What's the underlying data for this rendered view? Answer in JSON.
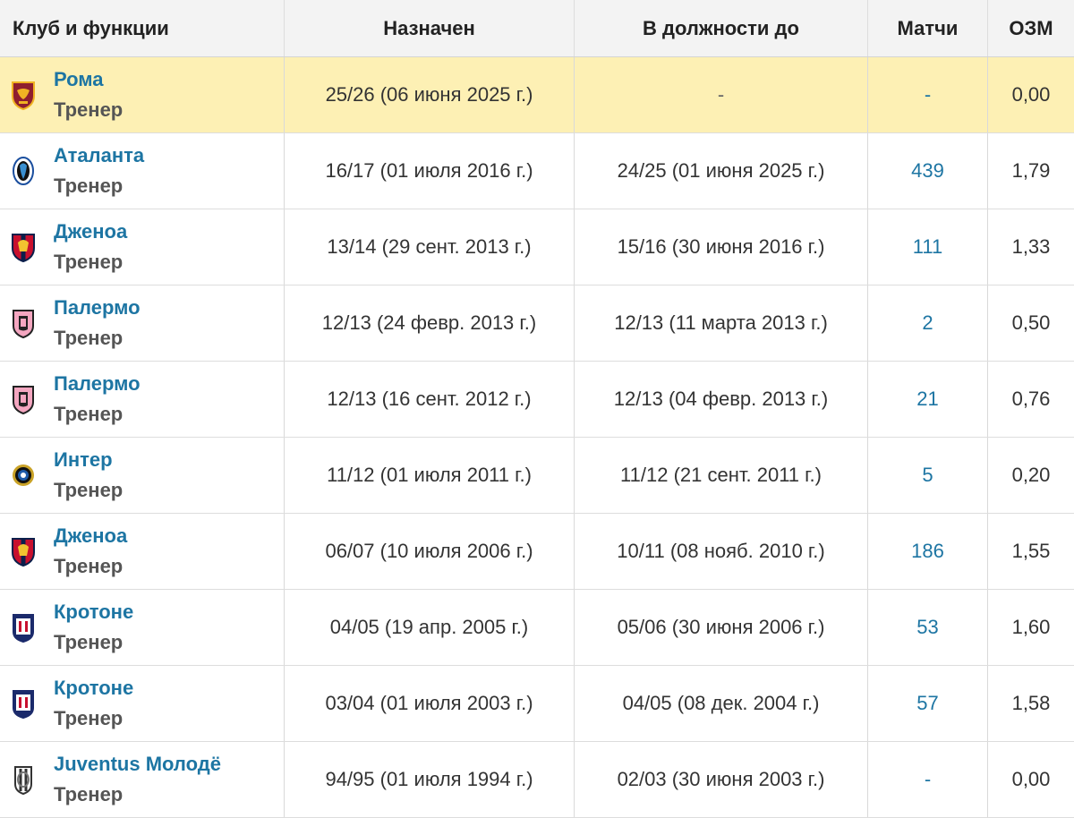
{
  "header": {
    "club": "Клуб и функции",
    "appointed": "Назначен",
    "until": "В должности до",
    "matches": "Матчи",
    "ppm": "ОЗМ"
  },
  "rows": [
    {
      "club": "Рома",
      "role": "Тренер",
      "crest": "roma-crest-icon",
      "appointed": "25/26 (06 июня 2025 г.)",
      "until": "-",
      "matches": "-",
      "ppm": "0,00",
      "current": true
    },
    {
      "club": "Аталанта",
      "role": "Тренер",
      "crest": "atalanta-crest-icon",
      "appointed": "16/17 (01 июля 2016 г.)",
      "until": "24/25 (01 июня 2025 г.)",
      "matches": "439",
      "ppm": "1,79"
    },
    {
      "club": "Дженоа",
      "role": "Тренер",
      "crest": "genoa-crest-icon",
      "appointed": "13/14 (29 сент. 2013 г.)",
      "until": "15/16 (30 июня 2016 г.)",
      "matches": "111",
      "ppm": "1,33"
    },
    {
      "club": "Палермо",
      "role": "Тренер",
      "crest": "palermo-crest-icon",
      "appointed": "12/13 (24 февр. 2013 г.)",
      "until": "12/13 (11 марта 2013 г.)",
      "matches": "2",
      "ppm": "0,50"
    },
    {
      "club": "Палермо",
      "role": "Тренер",
      "crest": "palermo-crest-icon",
      "appointed": "12/13 (16 сент. 2012 г.)",
      "until": "12/13 (04 февр. 2013 г.)",
      "matches": "21",
      "ppm": "0,76"
    },
    {
      "club": "Интер",
      "role": "Тренер",
      "crest": "inter-crest-icon",
      "appointed": "11/12 (01 июля 2011 г.)",
      "until": "11/12 (21 сент. 2011 г.)",
      "matches": "5",
      "ppm": "0,20"
    },
    {
      "club": "Дженоа",
      "role": "Тренер",
      "crest": "genoa-crest-icon",
      "appointed": "06/07 (10 июля 2006 г.)",
      "until": "10/11 (08 нояб. 2010 г.)",
      "matches": "186",
      "ppm": "1,55"
    },
    {
      "club": "Кротоне",
      "role": "Тренер",
      "crest": "crotone-crest-icon",
      "appointed": "04/05 (19 апр. 2005 г.)",
      "until": "05/06 (30 июня 2006 г.)",
      "matches": "53",
      "ppm": "1,60"
    },
    {
      "club": "Кротоне",
      "role": "Тренер",
      "crest": "crotone-crest-icon",
      "appointed": "03/04 (01 июля 2003 г.)",
      "until": "04/05 (08 дек. 2004 г.)",
      "matches": "57",
      "ppm": "1,58"
    },
    {
      "club": "Juventus Молодё",
      "role": "Тренер",
      "crest": "juventus-crest-icon",
      "appointed": "94/95 (01 июля 1994 г.)",
      "until": "02/03 (30 июня 2003 г.)",
      "matches": "-",
      "ppm": "0,00"
    }
  ],
  "colors": {
    "link": "#1d75a3",
    "current_row": "#fdf0b4",
    "header_bg": "#f3f3f3"
  }
}
